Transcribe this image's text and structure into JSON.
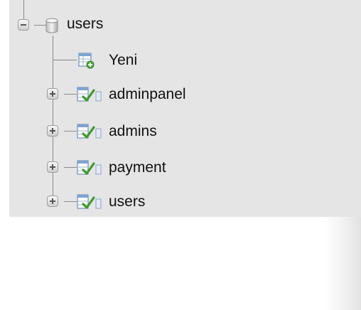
{
  "tree": {
    "database": {
      "name": "users",
      "icon": "database-icon",
      "expanded": true,
      "toggle_icon": "collapse-minus-icon"
    },
    "new_item": {
      "label": "Yeni",
      "icon": "new-table-icon"
    },
    "tables": [
      {
        "name": "adminpanel",
        "icon": "table-icon",
        "toggle_icon": "expand-plus-icon"
      },
      {
        "name": "admins",
        "icon": "table-icon",
        "toggle_icon": "expand-plus-icon"
      },
      {
        "name": "payment",
        "icon": "table-icon",
        "toggle_icon": "expand-plus-icon"
      },
      {
        "name": "users",
        "icon": "table-icon",
        "toggle_icon": "expand-plus-icon"
      }
    ]
  },
  "colors": {
    "panel_bg": "#e5e5e5",
    "tree_line": "#8a8a8a",
    "text": "#111111"
  }
}
